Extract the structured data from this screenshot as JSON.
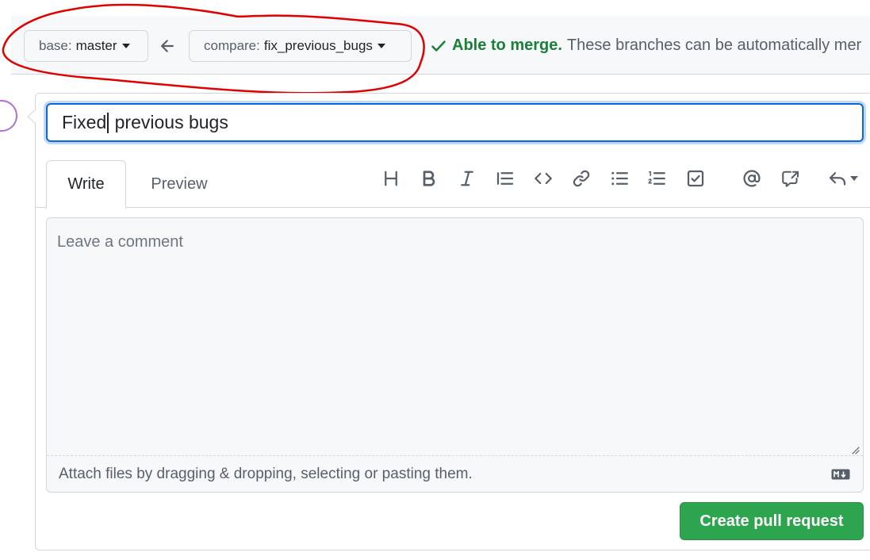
{
  "compare": {
    "base_prefix": "base:",
    "base_branch": "master",
    "compare_prefix": "compare:",
    "compare_branch": "fix_previous_bugs",
    "merge_status": "Able to merge.",
    "merge_description": "These branches can be automatically mer"
  },
  "form": {
    "title_before_cursor": "Fixed",
    "title_after_cursor": " previous bugs",
    "tabs": [
      "Write",
      "Preview"
    ],
    "toolbar_icons": [
      "heading-icon",
      "bold-icon",
      "italic-icon",
      "quote-icon",
      "code-icon",
      "link-icon",
      "unordered-list-icon",
      "ordered-list-icon",
      "task-list-icon",
      "mention-icon",
      "reference-icon",
      "reply-icon"
    ],
    "comment_placeholder": "Leave a comment",
    "attach_text": "Attach files by dragging & dropping, selecting or pasting them.",
    "submit_label": "Create pull request"
  },
  "colors": {
    "accent": "#0969da",
    "success": "#1a7f37",
    "button_green": "#2da44e",
    "annotation_red": "#e00000"
  }
}
